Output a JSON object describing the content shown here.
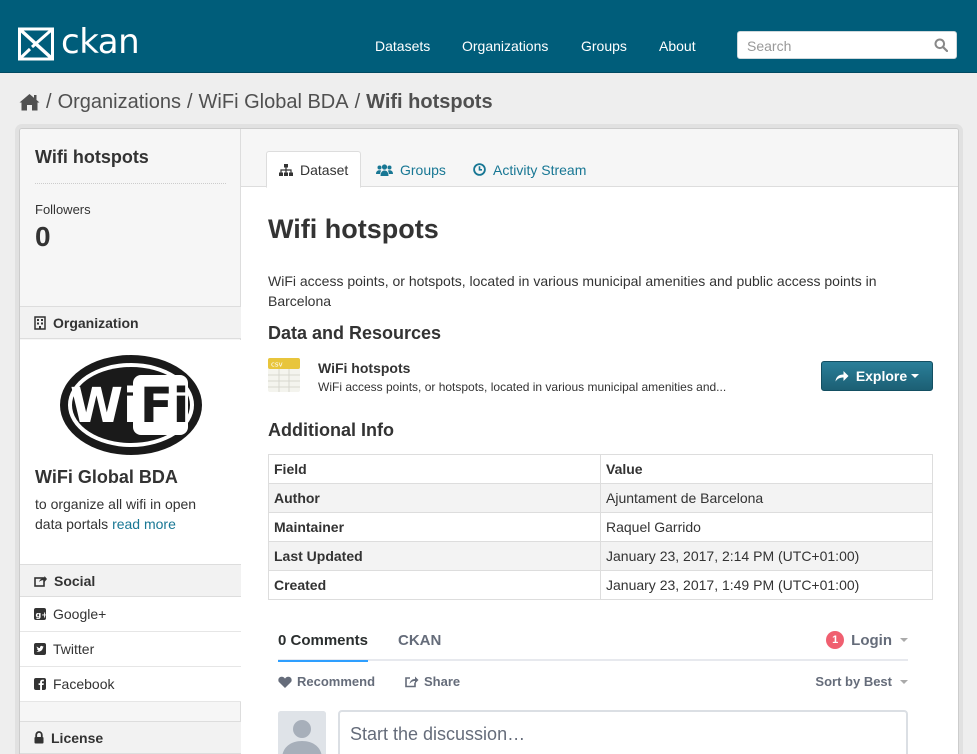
{
  "header": {
    "brand": "ckan",
    "nav": [
      "Datasets",
      "Organizations",
      "Groups",
      "About"
    ],
    "search_placeholder": "Search"
  },
  "breadcrumb": {
    "items": [
      "Organizations",
      "WiFi Global BDA"
    ],
    "current": "Wifi hotspots"
  },
  "sidebar": {
    "title": "Wifi hotspots",
    "followers_label": "Followers",
    "followers_count": "0",
    "organization_heading": "Organization",
    "org_name": "WiFi Global BDA",
    "org_description": "to organize all wifi in open data portals",
    "read_more": "read more",
    "social_heading": "Social",
    "social": [
      "Google+",
      "Twitter",
      "Facebook"
    ],
    "license_heading": "License"
  },
  "tabs": [
    "Dataset",
    "Groups",
    "Activity Stream"
  ],
  "dataset": {
    "title": "Wifi hotspots",
    "notes": "WiFi access points, or hotspots, located in various municipal amenities and public access points in Barcelona",
    "resources_heading": "Data and Resources",
    "resource": {
      "format": "csv",
      "title": "WiFi hotspots",
      "description": "WiFi access points, or hotspots, located in various municipal amenities and...",
      "explore_label": "Explore"
    },
    "additional_heading": "Additional Info",
    "table": {
      "headers": [
        "Field",
        "Value"
      ],
      "rows": [
        [
          "Author",
          "Ajuntament de Barcelona"
        ],
        [
          "Maintainer",
          "Raquel Garrido"
        ],
        [
          "Last Updated",
          "January 23, 2017, 2:14 PM (UTC+01:00)"
        ],
        [
          "Created",
          "January 23, 2017, 1:49 PM (UTC+01:00)"
        ]
      ]
    }
  },
  "comments": {
    "tab_comments": "0 Comments",
    "tab_site": "CKAN",
    "badge": "1",
    "login": "Login",
    "recommend": "Recommend",
    "share": "Share",
    "sort": "Sort by Best",
    "placeholder": "Start the discussion…"
  },
  "colors": {
    "header_bg": "#005d7a",
    "link": "#187794",
    "button": "#206b82",
    "badge": "#f05f70"
  }
}
